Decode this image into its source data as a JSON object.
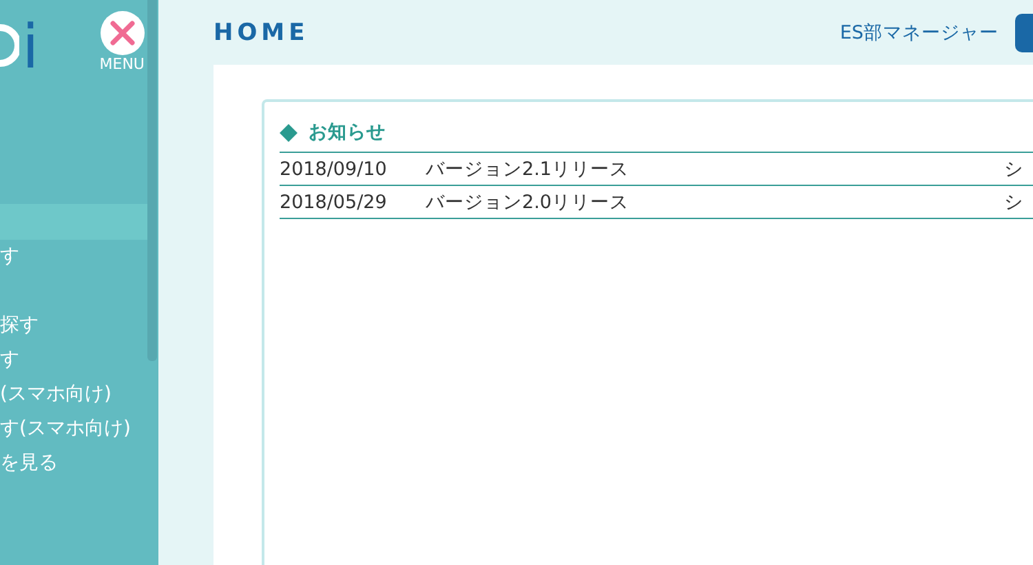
{
  "sidebar": {
    "logo": "i",
    "menu_label": "MENU",
    "items": [
      {
        "selected": true
      },
      {
        "label": "す",
        "selected": false
      },
      {
        "selected": false
      },
      {
        "label": "探す",
        "selected": false
      },
      {
        "label": "す",
        "selected": false
      },
      {
        "label": "(スマホ向け)",
        "selected": false
      },
      {
        "label": "す(スマホ向け)",
        "selected": false
      },
      {
        "label": "を見る",
        "selected": false
      }
    ]
  },
  "header": {
    "title": "HOME",
    "user": "ES部マネージャー"
  },
  "notices": {
    "title": "お知らせ",
    "rows": [
      {
        "date": "2018/09/10",
        "subject": "バージョン2.1リリース",
        "column_3": "シ"
      },
      {
        "date": "2018/05/29",
        "subject": "バージョン2.0リリース",
        "column_3": "シ"
      }
    ]
  }
}
